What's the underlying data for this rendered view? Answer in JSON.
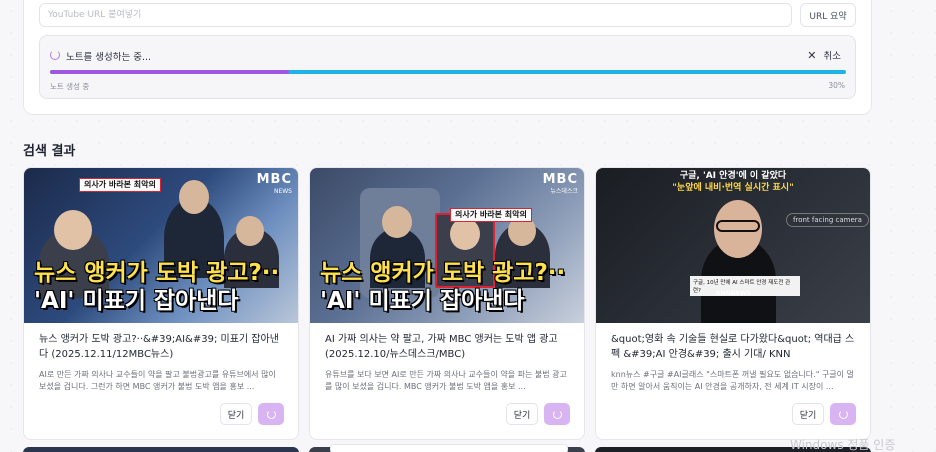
{
  "input": {
    "placeholder": "YouTube URL 붙여넣기",
    "summarize_label": "URL 요약"
  },
  "progress": {
    "label": "노트를 생성하는 중...",
    "cancel_label": "취소",
    "sub_status": "노트 생성 중",
    "percent_text": "30%",
    "percent_value": 0.3,
    "colors": {
      "fill": "#9f57e0",
      "track": "#1eb3e6"
    }
  },
  "results": {
    "title": "검색 결과",
    "items": [
      {
        "title": "뉴스 앵커가 도박 광고?··&#39;AI&#39; 미표기 잡아낸다 (2025.12.11/12MBC뉴스)",
        "desc": "AI로 만든 가짜 의사나 교수들이 약을 팔고 불법광고를 유튜브에서 많이 보셨을 겁니다. 그런가 하면 MBC 앵커가 불법 도박 앱을 홍보 ...",
        "thumb_line1": "뉴스 앵커가 도박 광고?··",
        "thumb_line2": "'AI' 미표기 잡아낸다",
        "thumb_brand": "MBC",
        "thumb_brand_sub": "NEWS",
        "thumb_tag": "의사가 바라본 최악의",
        "close_label": "닫기"
      },
      {
        "title": "AI 가짜 의사는 약 팔고, 가짜 MBC 앵커는 도박 앱 광고 (2025.12.10/뉴스데스크/MBC)",
        "desc": "유튜브를 보다 보면 AI로 만든 가짜 의사나 교수들이 약을 파는 불법 광고를 많이 보셨을 겁니다. MBC 앵커가 불법 도박 앱을 홍보 ...",
        "thumb_line1": "뉴스 앵커가 도박 광고?··",
        "thumb_line2": "'AI' 미표기 잡아낸다",
        "thumb_brand": "MBC",
        "thumb_brand_sub": "뉴스데스크",
        "thumb_tag": "의사가 바라본 최악의",
        "close_label": "닫기"
      },
      {
        "title": "&quot;영화 속 기술들 현실로 다가왔다&quot; 역대급 스펙 &#39;AI 안경&#39; 출시 기대/ KNN",
        "desc": "knn뉴스 #구글 #AI글래스 \"스마트폰 꺼낼 필요도 없습니다.\" 구글이 멀만 하면 알아서 움직이는 AI 안경을 공개하자, 전 세계 IT 시장이 ...",
        "thumb_line1": "구글, 'AI 안경'에 이 같았다",
        "thumb_line2": "\"눈앞에 내비·번역 실시간 표시\"",
        "thumb_brand": "KNNNEWS",
        "thumb_caption": "front facing camera",
        "thumb_ticker": "구글, 10년 만에 AI 스마트 안경 재도전 관련?",
        "close_label": "닫기"
      }
    ]
  },
  "watermark": "Windows 정품 인증"
}
